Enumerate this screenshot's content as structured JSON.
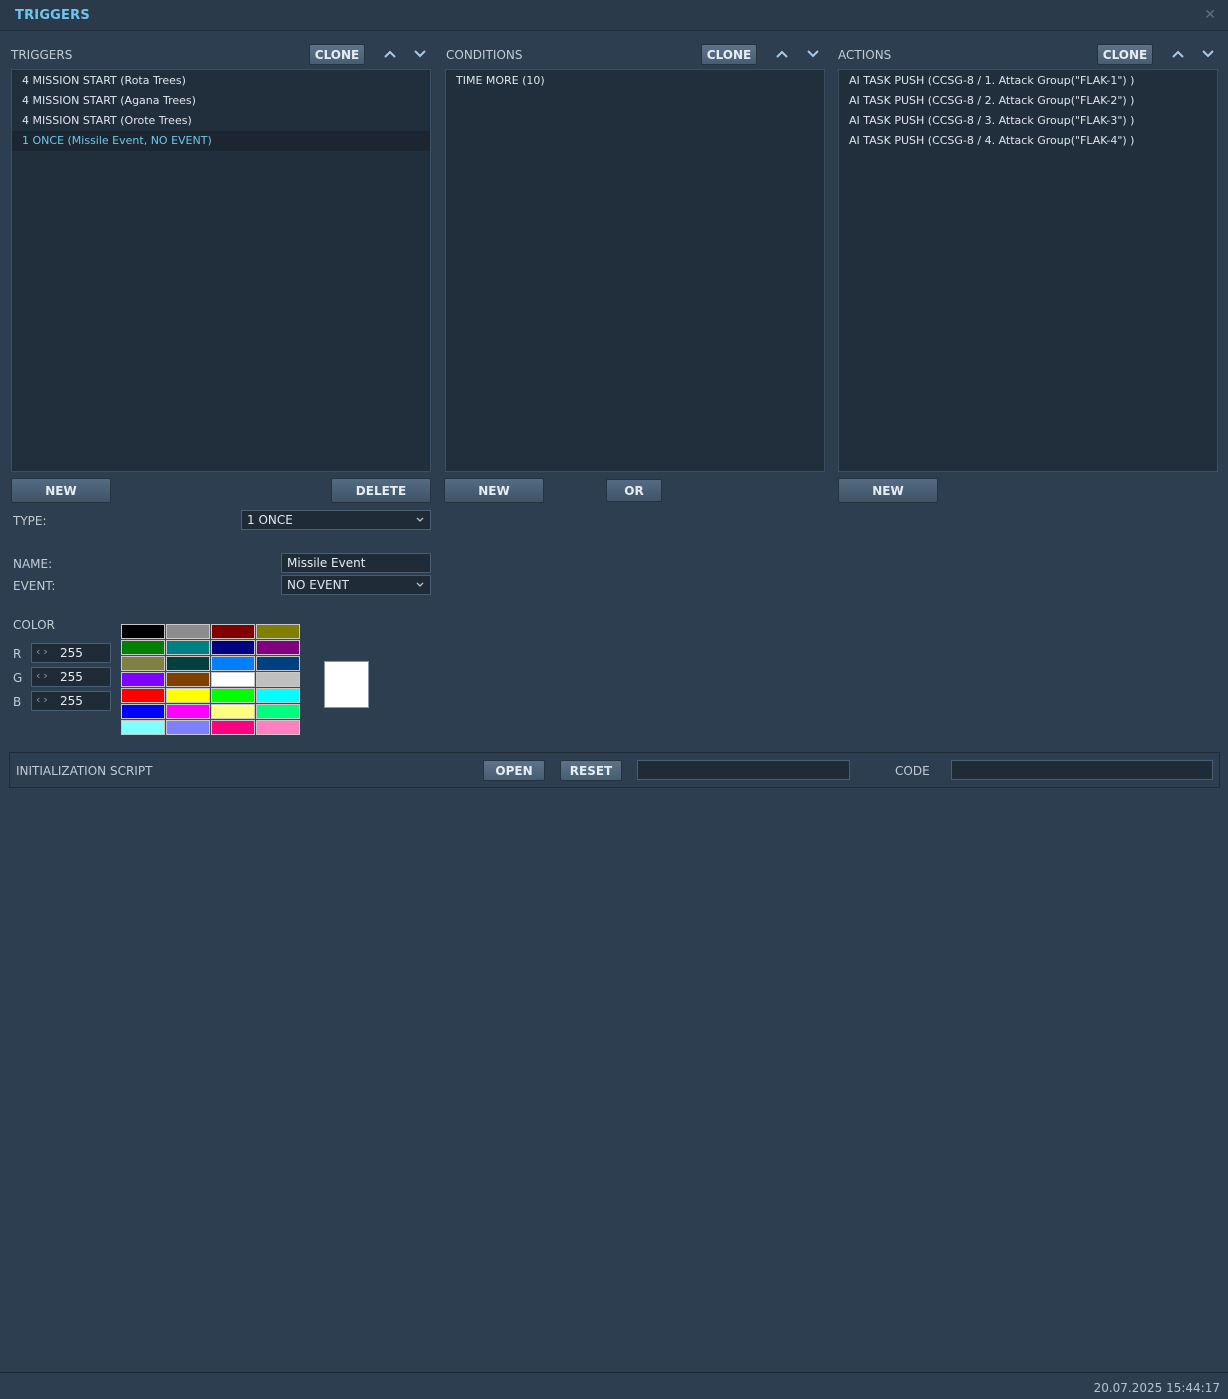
{
  "window": {
    "title": "TRIGGERS"
  },
  "triggers": {
    "label": "TRIGGERS",
    "clone_label": "CLONE",
    "items": [
      "4 MISSION START (Rota Trees)",
      "4 MISSION START (Agana Trees)",
      "4 MISSION START (Orote Trees)",
      "1 ONCE (Missile Event, NO EVENT)"
    ],
    "selected_index": 3,
    "new_label": "NEW",
    "delete_label": "DELETE"
  },
  "conditions": {
    "label": "CONDITIONS",
    "clone_label": "CLONE",
    "items": [
      "TIME MORE (10)"
    ],
    "new_label": "NEW",
    "or_label": "OR"
  },
  "actions": {
    "label": "ACTIONS",
    "clone_label": "CLONE",
    "items": [
      "AI TASK PUSH (CCSG-8 / 1. Attack Group(\"FLAK-1\") )",
      "AI TASK PUSH (CCSG-8 / 2. Attack Group(\"FLAK-2\") )",
      "AI TASK PUSH (CCSG-8 / 3. Attack Group(\"FLAK-3\") )",
      "AI TASK PUSH (CCSG-8 / 4. Attack Group(\"FLAK-4\") )"
    ],
    "new_label": "NEW"
  },
  "form": {
    "type_label": "TYPE:",
    "type_value": "1 ONCE",
    "name_label": "NAME:",
    "name_value": "Missile Event",
    "event_label": "EVENT:",
    "event_value": "NO EVENT"
  },
  "color": {
    "label": "COLOR",
    "r_label": "R",
    "r_value": "255",
    "g_label": "G",
    "g_value": "255",
    "b_label": "B",
    "b_value": "255",
    "preview": "#ffffff",
    "palette": [
      "#000000",
      "#8c8c8c",
      "#800000",
      "#808000",
      "#008000",
      "#008080",
      "#000080",
      "#800080",
      "#808040",
      "#004040",
      "#0080ff",
      "#004080",
      "#8000ff",
      "#804000",
      "#ffffff",
      "#c0c0c0",
      "#ff0000",
      "#ffff00",
      "#00ff00",
      "#00ffff",
      "#0000ff",
      "#ff00ff",
      "#ffff80",
      "#00ff80",
      "#80ffff",
      "#8080ff",
      "#ff0080",
      "#ff80c0"
    ]
  },
  "init_script": {
    "label": "INITIALIZATION SCRIPT",
    "open_label": "OPEN",
    "reset_label": "RESET",
    "file_value": "",
    "code_label": "CODE",
    "code_value": ""
  },
  "status": {
    "timestamp": "20.07.2025 15:44:17"
  }
}
